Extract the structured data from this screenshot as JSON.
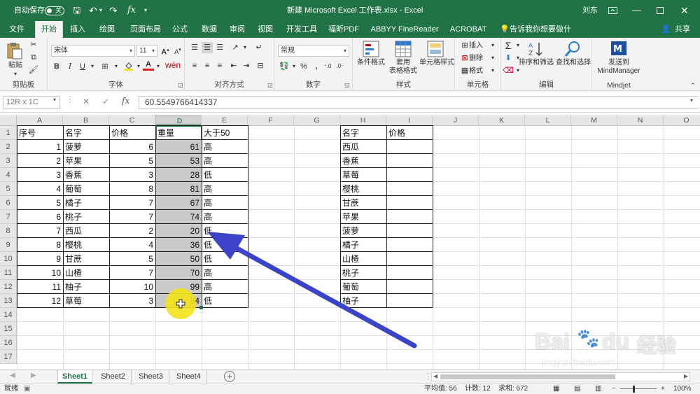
{
  "titlebar": {
    "autosave": "自动保存",
    "toggle_state": "关",
    "doc_title": "新建 Microsoft Excel 工作表.xlsx  -  Excel",
    "user": "刘东"
  },
  "tabs": [
    "文件",
    "开始",
    "插入",
    "绘图",
    "页面布局",
    "公式",
    "数据",
    "审阅",
    "视图",
    "开发工具",
    "福昕PDF",
    "ABBYY FineReader 12",
    "ACROBAT"
  ],
  "tellme": "告诉我你想要做什么",
  "share": "共享",
  "ribbon": {
    "paste": "粘贴",
    "clipboard": "剪贴板",
    "font_name": "宋体",
    "font_size": "11",
    "font_group": "字体",
    "align_group": "对齐方式",
    "number_format": "常规",
    "number_group": "数字",
    "cond_format": "条件格式",
    "table_format_1": "套用",
    "table_format_2": "表格格式",
    "cell_style": "单元格样式",
    "style_group": "样式",
    "insert": "插入",
    "delete": "删除",
    "format": "格式",
    "cells_group": "单元格",
    "sort_filter": "排序和筛选",
    "find_select": "查找和选择",
    "edit_group": "编辑",
    "send_to_1": "发送到",
    "send_to_2": "MindManager",
    "mindjet_group": "Mindjet"
  },
  "formula_bar": {
    "name_box": "12R x 1C",
    "value": "60.5549766414337"
  },
  "columns": [
    "A",
    "B",
    "C",
    "D",
    "E",
    "F",
    "G",
    "H",
    "I",
    "J",
    "K",
    "L",
    "M",
    "N",
    "O"
  ],
  "selected_column": "D",
  "rows": [
    "1",
    "2",
    "3",
    "4",
    "5",
    "6",
    "7",
    "8",
    "9",
    "10",
    "11",
    "12",
    "13",
    "14",
    "15",
    "16",
    "17"
  ],
  "table1": {
    "headers": [
      "序号",
      "名字",
      "价格",
      "重量",
      "大于50"
    ],
    "rows": [
      [
        "1",
        "菠萝",
        "6",
        "61",
        "高"
      ],
      [
        "2",
        "苹果",
        "5",
        "53",
        "高"
      ],
      [
        "3",
        "香蕉",
        "3",
        "28",
        "低"
      ],
      [
        "4",
        "葡萄",
        "8",
        "81",
        "高"
      ],
      [
        "5",
        "橘子",
        "7",
        "67",
        "高"
      ],
      [
        "6",
        "桃子",
        "7",
        "74",
        "高"
      ],
      [
        "7",
        "西瓜",
        "2",
        "20",
        "低"
      ],
      [
        "8",
        "樱桃",
        "4",
        "36",
        "低"
      ],
      [
        "9",
        "甘蔗",
        "5",
        "50",
        "低"
      ],
      [
        "10",
        "山楂",
        "7",
        "70",
        "高"
      ],
      [
        "11",
        "柚子",
        "10",
        "99",
        "高"
      ],
      [
        "12",
        "草莓",
        "3",
        "34",
        "低"
      ]
    ]
  },
  "table2": {
    "headers": [
      "名字",
      "价格"
    ],
    "names": [
      "西瓜",
      "香蕉",
      "草莓",
      "樱桃",
      "甘蔗",
      "苹果",
      "菠萝",
      "橘子",
      "山楂",
      "桃子",
      "葡萄",
      "柚子"
    ]
  },
  "sheets": [
    "Sheet1",
    "Sheet2",
    "Sheet3",
    "Sheet4"
  ],
  "active_sheet": "Sheet1",
  "status": {
    "mode": "就绪",
    "average": "平均值: 56",
    "count": "计数: 12",
    "sum": "求和: 672",
    "zoom": "100%"
  },
  "watermark": {
    "brand": "Bai",
    "brand2": "经验",
    "url": "jingyan.baidu.com"
  },
  "colors": {
    "excel_green": "#217346",
    "arrow": "#3b43c8",
    "highlight": "#f3e21b"
  }
}
